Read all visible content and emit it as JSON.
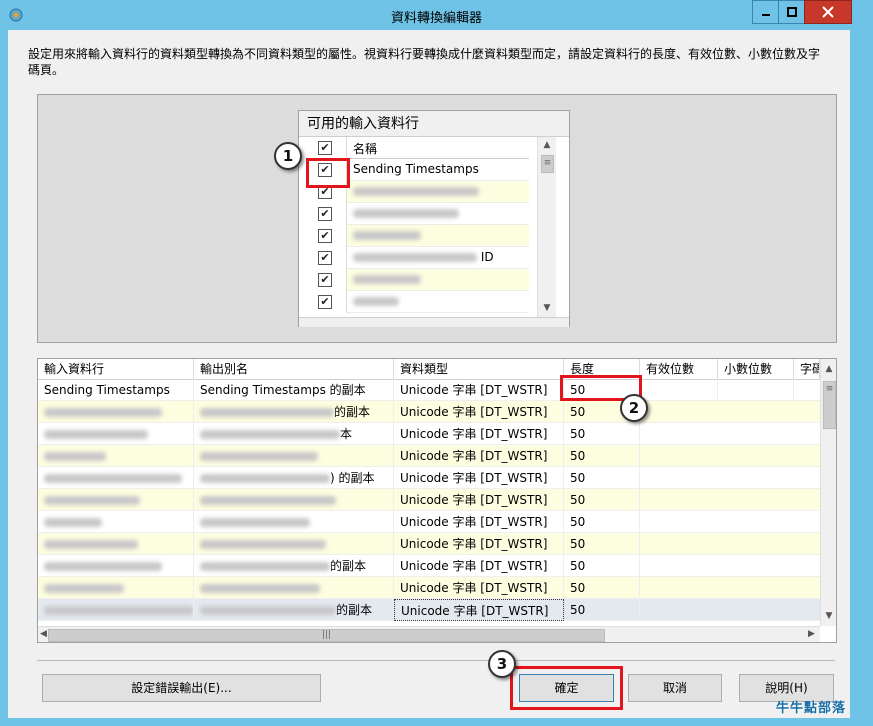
{
  "window": {
    "title": "資料轉換編輯器"
  },
  "description": "設定用來將輸入資料行的資料類型轉換為不同資料類型的屬性。視資料行要轉換成什麼資料類型而定，請設定資料行的長度、有效位數、小數位數及字碼頁。",
  "available_columns": {
    "title": "可用的輸入資料行",
    "header_label": "名稱",
    "rows": [
      {
        "name": "Sending Timestamps",
        "checked": true
      },
      {
        "name": "",
        "checked": true
      },
      {
        "name": "",
        "checked": true
      },
      {
        "name": "",
        "checked": true
      },
      {
        "name": "ID",
        "checked": true
      },
      {
        "name": "",
        "checked": true
      },
      {
        "name": "",
        "checked": true
      }
    ]
  },
  "grid": {
    "headers": [
      "輸入資料行",
      "輸出別名",
      "資料類型",
      "長度",
      "有效位數",
      "小數位數",
      "字碼"
    ],
    "rows": [
      {
        "input": "Sending Timestamps",
        "alias": "Sending Timestamps 的副本",
        "type": "Unicode 字串 [DT_WSTR]",
        "length": "50"
      },
      {
        "input": "",
        "alias": "的副本",
        "type": "Unicode 字串 [DT_WSTR]",
        "length": "50"
      },
      {
        "input": "",
        "alias": "本",
        "type": "Unicode 字串 [DT_WSTR]",
        "length": "50"
      },
      {
        "input": "",
        "alias": "",
        "type": "Unicode 字串 [DT_WSTR]",
        "length": "50"
      },
      {
        "input": "",
        "alias": ") 的副本",
        "type": "Unicode 字串 [DT_WSTR]",
        "length": "50"
      },
      {
        "input": "",
        "alias": "",
        "type": "Unicode 字串 [DT_WSTR]",
        "length": "50"
      },
      {
        "input": "",
        "alias": "",
        "type": "Unicode 字串 [DT_WSTR]",
        "length": "50"
      },
      {
        "input": "",
        "alias": "",
        "type": "Unicode 字串 [DT_WSTR]",
        "length": "50"
      },
      {
        "input": "",
        "alias": "的副本",
        "type": "Unicode 字串 [DT_WSTR]",
        "length": "50"
      },
      {
        "input": "",
        "alias": "",
        "type": "Unicode 字串 [DT_WSTR]",
        "length": "50"
      },
      {
        "input": "",
        "alias": "的副本",
        "type": "Unicode 字串 [DT_WSTR]",
        "length": "50"
      }
    ]
  },
  "buttons": {
    "error_output": "設定錯誤輸出(E)...",
    "ok": "確定",
    "cancel": "取消",
    "help": "說明(H)"
  },
  "callouts": [
    "1",
    "2",
    "3"
  ],
  "watermark": "牛牛點部落",
  "colors": {
    "frame": "#6ec3e6",
    "close": "#c7372a",
    "highlight": "#e2141c",
    "row_alt": "#fdfde0"
  }
}
